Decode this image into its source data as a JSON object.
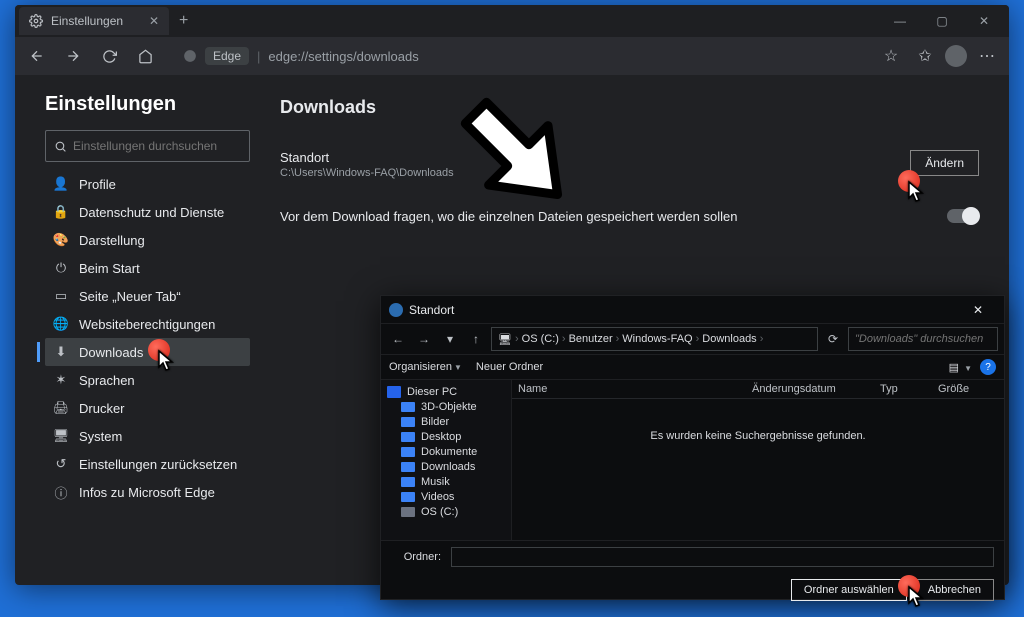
{
  "tab": {
    "title": "Einstellungen"
  },
  "address": {
    "badge": "Edge",
    "url": "edge://settings/downloads"
  },
  "sidebar": {
    "title": "Einstellungen",
    "search_placeholder": "Einstellungen durchsuchen",
    "items": [
      {
        "icon": "👤",
        "label": "Profile"
      },
      {
        "icon": "🔒",
        "label": "Datenschutz und Dienste"
      },
      {
        "icon": "🎨",
        "label": "Darstellung"
      },
      {
        "icon": "⏻",
        "label": "Beim Start"
      },
      {
        "icon": "▭",
        "label": "Seite „Neuer Tab“"
      },
      {
        "icon": "🌐",
        "label": "Websiteberechtigungen"
      },
      {
        "icon": "⬇",
        "label": "Downloads"
      },
      {
        "icon": "✶",
        "label": "Sprachen"
      },
      {
        "icon": "🖨",
        "label": "Drucker"
      },
      {
        "icon": "🖥",
        "label": "System"
      },
      {
        "icon": "↺",
        "label": "Einstellungen zurücksetzen"
      },
      {
        "icon": "ⓘ",
        "label": "Infos zu Microsoft Edge"
      }
    ]
  },
  "main": {
    "heading": "Downloads",
    "location": {
      "label": "Standort",
      "path": "C:\\Users\\Windows-FAQ\\Downloads",
      "change_btn": "Ändern"
    },
    "ask": {
      "label": "Vor dem Download fragen, wo die einzelnen Dateien gespeichert werden sollen"
    }
  },
  "dialog": {
    "title": "Standort",
    "breadcrumb": [
      "OS (C:)",
      "Benutzer",
      "Windows-FAQ",
      "Downloads"
    ],
    "search_placeholder": "\"Downloads\" durchsuchen",
    "toolbar": {
      "organize": "Organisieren",
      "newfolder": "Neuer Ordner"
    },
    "tree": [
      {
        "label": "Dieser PC",
        "cls": "pc",
        "indent": false
      },
      {
        "label": "3D-Objekte",
        "cls": "",
        "indent": true
      },
      {
        "label": "Bilder",
        "cls": "",
        "indent": true
      },
      {
        "label": "Desktop",
        "cls": "",
        "indent": true
      },
      {
        "label": "Dokumente",
        "cls": "",
        "indent": true
      },
      {
        "label": "Downloads",
        "cls": "dl",
        "indent": true
      },
      {
        "label": "Musik",
        "cls": "",
        "indent": true
      },
      {
        "label": "Videos",
        "cls": "",
        "indent": true
      },
      {
        "label": "OS (C:)",
        "cls": "disk",
        "indent": true
      }
    ],
    "columns": {
      "name": "Name",
      "date": "Änderungsdatum",
      "type": "Typ",
      "size": "Größe"
    },
    "empty": "Es wurden keine Suchergebnisse gefunden.",
    "folder_label": "Ordner:",
    "ok": "Ordner auswählen",
    "cancel": "Abbrechen",
    "help": "?"
  }
}
